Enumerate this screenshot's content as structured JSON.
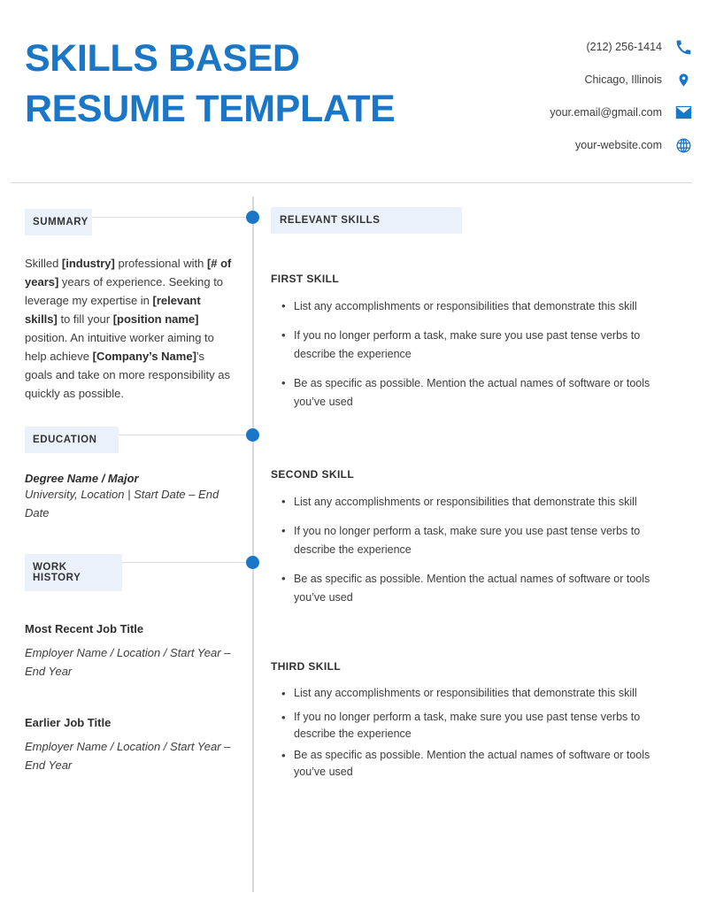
{
  "header": {
    "title_line1": "SKILLS BASED",
    "title_line2": "RESUME TEMPLATE",
    "accent_color": "#1a76c6",
    "contacts": [
      {
        "text": "(212) 256-1414",
        "icon": "phone-icon"
      },
      {
        "text": "Chicago, Illinois",
        "icon": "location-pin-icon"
      },
      {
        "text": "your.email@gmail.com",
        "icon": "envelope-icon"
      },
      {
        "text": "your-website.com",
        "icon": "globe-icon"
      }
    ]
  },
  "left": {
    "summary_label": "SUMMARY",
    "summary_text_parts": {
      "p1": "Skilled ",
      "b1": "[industry]",
      "p2": " professional with ",
      "b2": "[# of years]",
      "p3": " years of experience. Seeking to leverage my expertise in ",
      "b3": "[relevant skills]",
      "p4": " to fill your ",
      "b4": "[position name]",
      "p5": " position. An intuitive worker aiming to help achieve ",
      "b5": "[Company’s Name]",
      "p6": "’s goals and take on more responsibility as quickly as possible."
    },
    "education_label": "EDUCATION",
    "education": {
      "degree": "Degree Name / Major",
      "details": "University, Location | Start Date – End Date"
    },
    "work_label": "WORK HISTORY",
    "jobs": [
      {
        "title": "Most Recent Job Title",
        "details": "Employer Name / Location / Start Year – End Year"
      },
      {
        "title": "Earlier Job Title",
        "details": "Employer Name / Location / Start Year – End Year"
      }
    ]
  },
  "right": {
    "skills_label": "RELEVANT SKILLS",
    "bullet_glyph": "•",
    "skills": [
      {
        "title": "FIRST SKILL",
        "bullets": [
          "List any accomplishments or responsibilities that demonstrate this skill",
          "If you no longer perform a task, make sure you use past tense verbs to describe the experience",
          "Be as specific as possible. Mention the actual names of software or tools you’ve used"
        ]
      },
      {
        "title": "SECOND SKILL",
        "bullets": [
          "List any accomplishments or responsibilities that demonstrate this skill",
          "If you no longer perform a task, make sure you use past tense verbs to describe the experience",
          "Be as specific as possible. Mention the actual names of software or tools you’ve used"
        ]
      },
      {
        "title": "THIRD SKILL",
        "bullets": [
          "List any accomplishments or responsibilities that demonstrate this skill",
          "If you no longer perform a task, make sure you use past tense verbs to describe the experience",
          "Be as specific as possible. Mention the actual names of software or tools you’ve used"
        ]
      }
    ]
  }
}
